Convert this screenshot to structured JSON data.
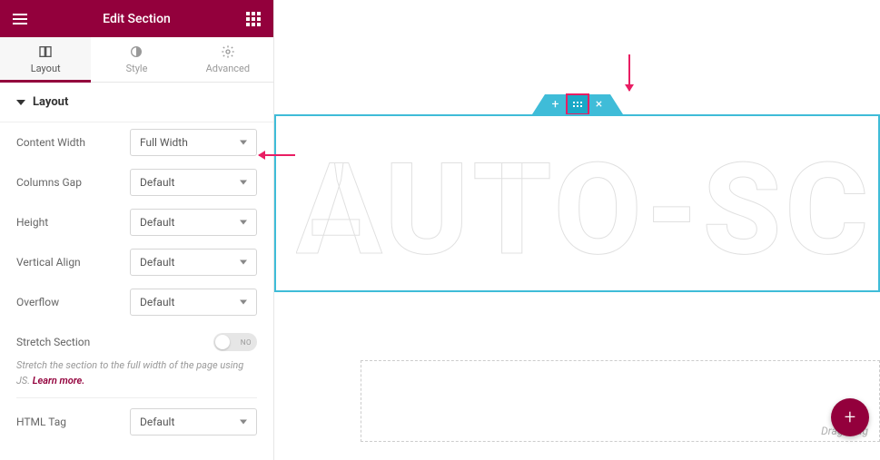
{
  "header": {
    "title": "Edit Section"
  },
  "tabs": {
    "layout": "Layout",
    "style": "Style",
    "advanced": "Advanced"
  },
  "section": {
    "title": "Layout"
  },
  "controls": {
    "content_width": {
      "label": "Content Width",
      "value": "Full Width"
    },
    "columns_gap": {
      "label": "Columns Gap",
      "value": "Default"
    },
    "height": {
      "label": "Height",
      "value": "Default"
    },
    "vertical_align": {
      "label": "Vertical Align",
      "value": "Default"
    },
    "overflow": {
      "label": "Overflow",
      "value": "Default"
    },
    "stretch": {
      "label": "Stretch Section",
      "state": "NO",
      "help": "Stretch the section to the full width of the page using JS. ",
      "learn_more": "Learn more."
    },
    "html_tag": {
      "label": "HTML Tag",
      "value": "Default"
    }
  },
  "canvas": {
    "big_text": "AUTO-SC",
    "drop_hint": "Drag widg"
  }
}
